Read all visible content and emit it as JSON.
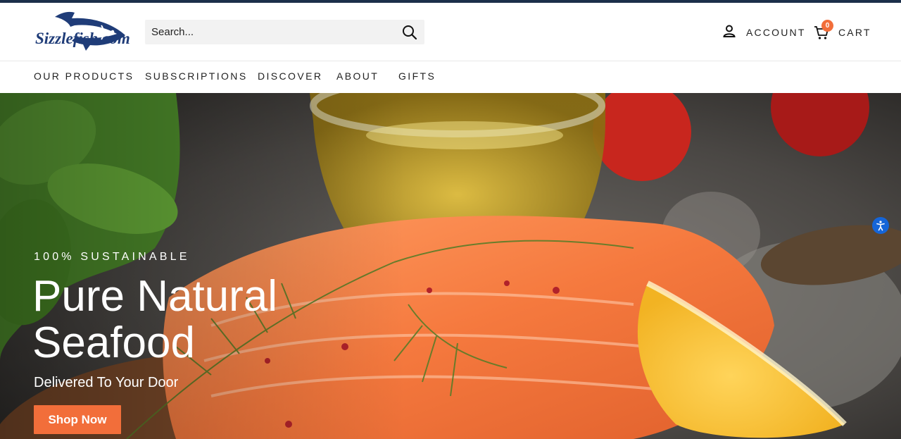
{
  "brand": {
    "logo_text": "Sizzlefish.com"
  },
  "search": {
    "placeholder": "Search..."
  },
  "header": {
    "account_label": "ACCOUNT",
    "cart_label": "CART",
    "cart_count": "0"
  },
  "nav": {
    "items": [
      {
        "label": "OUR PRODUCTS"
      },
      {
        "label": "SUBSCRIPTIONS"
      },
      {
        "label": "DISCOVER"
      },
      {
        "label": "ABOUT"
      },
      {
        "label": "GIFTS"
      }
    ]
  },
  "hero": {
    "eyebrow": "100% SUSTAINABLE",
    "headline": "Pure Natural Seafood",
    "subhead": "Delivered To Your Door",
    "cta_label": "Shop Now",
    "image": "salmon-fillet-with-dill-lemon-olive-oil"
  },
  "icons": [
    "search-icon",
    "user-icon",
    "cart-icon",
    "accessibility-icon"
  ],
  "colors": {
    "accent": "#f26e3a",
    "top_rule": "#1c2f4a",
    "logo": "#1f3c78",
    "a11y": "#1565d8"
  }
}
